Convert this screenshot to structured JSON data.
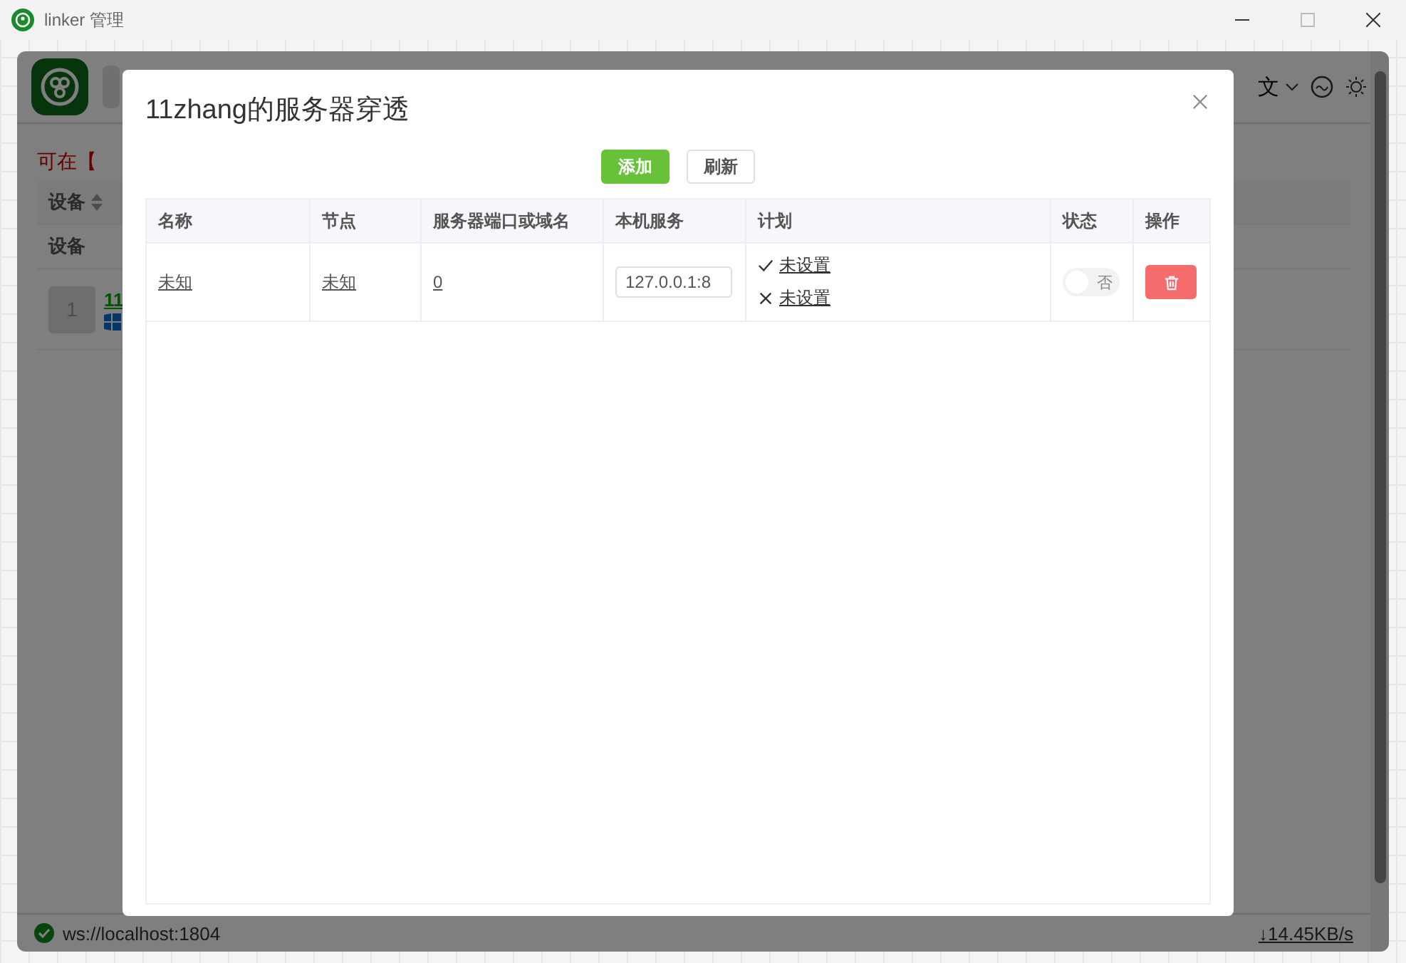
{
  "window": {
    "title": "linker 管理"
  },
  "app": {
    "notice": "可在【",
    "sort_column": "设备",
    "filter_label": "设备",
    "rows": [
      {
        "index": "1",
        "name": "11"
      }
    ],
    "language": "文",
    "status_bar": {
      "connection": "ws://localhost:1804",
      "download": "↓14.45KB/s"
    }
  },
  "dialog": {
    "title": "11zhang的服务器穿透",
    "buttons": [
      {
        "label": "添加",
        "kind": "primary"
      },
      {
        "label": "刷新",
        "kind": "default"
      }
    ],
    "table": {
      "columns": [
        "名称",
        "节点",
        "服务器端口或域名",
        "本机服务",
        "计划",
        "状态",
        "操作"
      ],
      "rows": [
        {
          "name": "未知",
          "node": "未知",
          "server_port": "0",
          "local_service": "127.0.0.1:8",
          "plan": [
            {
              "kind": "start",
              "label": "未设置"
            },
            {
              "kind": "stop",
              "label": "未设置"
            }
          ],
          "status": {
            "on": false,
            "label": "否"
          }
        }
      ]
    }
  }
}
